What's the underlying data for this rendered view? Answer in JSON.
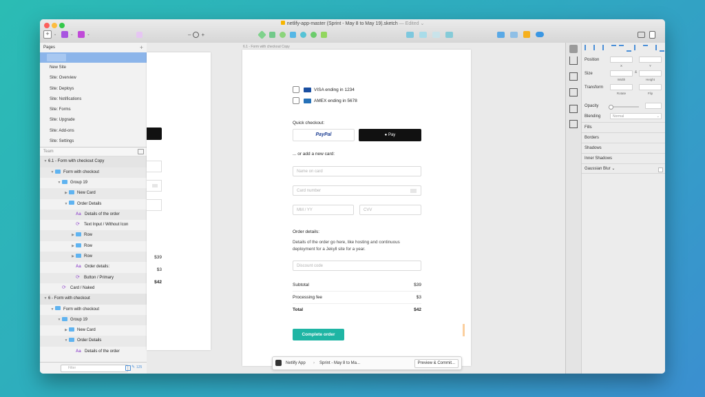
{
  "window": {
    "title": "netlify-app-master (Sprint - May 8 to May 19).sketch",
    "edited": "— Edited ⌄",
    "zoom_minus": "–",
    "zoom_plus": "+"
  },
  "pages_panel": {
    "header": "Pages",
    "add": "+",
    "pages": [
      "New Site",
      "Site: Overview",
      "Site: Deploys",
      "Site: Notifications",
      "Site: Forms",
      "Site: Upgrade",
      "Site: Add-ons",
      "Site: Settings"
    ]
  },
  "layers_panel": {
    "section": "Team",
    "layers": [
      {
        "label": "6.1 - Form with checkout Copy",
        "indent": 0,
        "icon": "none",
        "tri": "▼"
      },
      {
        "label": "Form with checkout",
        "indent": 1,
        "icon": "folder",
        "tri": "▼"
      },
      {
        "label": "Group 19",
        "indent": 2,
        "icon": "folder",
        "tri": "▼"
      },
      {
        "label": "New Card",
        "indent": 3,
        "icon": "folder",
        "tri": "▶"
      },
      {
        "label": "Order Details",
        "indent": 3,
        "icon": "folder",
        "tri": "▼"
      },
      {
        "label": "Details of the order",
        "indent": 4,
        "icon": "text",
        "tri": ""
      },
      {
        "label": "Text Input / Without Icon",
        "indent": 4,
        "icon": "symbol",
        "tri": ""
      },
      {
        "label": "Row",
        "indent": 4,
        "icon": "folder",
        "tri": "▶"
      },
      {
        "label": "Row",
        "indent": 4,
        "icon": "folder",
        "tri": "▶"
      },
      {
        "label": "Row",
        "indent": 4,
        "icon": "folder",
        "tri": "▶"
      },
      {
        "label": "Order details:",
        "indent": 4,
        "icon": "text",
        "tri": ""
      },
      {
        "label": "Button / Primary",
        "indent": 4,
        "icon": "symbol",
        "tri": ""
      },
      {
        "label": "Card / Naked",
        "indent": 2,
        "icon": "symbol",
        "tri": ""
      },
      {
        "label": "6 - Form with checkout",
        "indent": 0,
        "icon": "none",
        "tri": "▼"
      },
      {
        "label": "Form with checkout",
        "indent": 1,
        "icon": "folder",
        "tri": "▼"
      },
      {
        "label": "Group 19",
        "indent": 2,
        "icon": "folder",
        "tri": "▼"
      },
      {
        "label": "New Card",
        "indent": 3,
        "icon": "folder",
        "tri": "▶"
      },
      {
        "label": "Order Details",
        "indent": 3,
        "icon": "folder",
        "tri": "▼"
      },
      {
        "label": "Details of the order",
        "indent": 4,
        "icon": "text",
        "tri": ""
      }
    ],
    "filter_placeholder": "Filter",
    "count": "125"
  },
  "canvas": {
    "artboard_label": "6.1 - Form with checkout Copy",
    "cards": [
      {
        "label": "VISA ending in 1234"
      },
      {
        "label": "AMEX ending in 5678"
      }
    ],
    "quick_checkout": "Quick checkout:",
    "paypal": "PayPal",
    "applepay": " Pay",
    "add_card": "... or add a new card:",
    "name_placeholder": "Name on card",
    "number_placeholder": "Card number",
    "expiry_placeholder": "MM / YY",
    "cvv_placeholder": "CVV",
    "order_heading": "Order details:",
    "order_description": "Details of the order go here, like hosting and continuous deployment for a Jekyll site for a year.",
    "discount_placeholder": "Discount code",
    "subtotal_label": "Subtotal",
    "subtotal_value": "$39",
    "fee_label": "Processing fee",
    "fee_value": "$3",
    "total_label": "Total",
    "total_value": "$42",
    "complete_button": "Complete order",
    "left_artboard": {
      "v1": "$39",
      "v2": "$3",
      "v3": "$42"
    }
  },
  "bottom_bar": {
    "app": "Netlify App",
    "sep": "›",
    "page": "Sprint - May 8 to Ma...",
    "action": "Preview & Commit..."
  },
  "inspector": {
    "position": "Position",
    "x": "X",
    "y": "Y",
    "size": "Size",
    "width": "Width",
    "height": "Height",
    "transform": "Transform",
    "rotate": "Rotate",
    "flip": "Flip",
    "opacity": "Opacity",
    "blending": "Blending",
    "blending_value": "Normal",
    "fills": "Fills",
    "borders": "Borders",
    "shadows": "Shadows",
    "inner_shadows": "Inner Shadows",
    "gaussian_blur": "Gaussian Blur ⌄"
  },
  "colors": {
    "accent_teal": "#1fb5a4",
    "selection_blue": "#8cb5ea",
    "folder_blue": "#5fb3f0",
    "symbol_purple": "#9b59d0"
  }
}
